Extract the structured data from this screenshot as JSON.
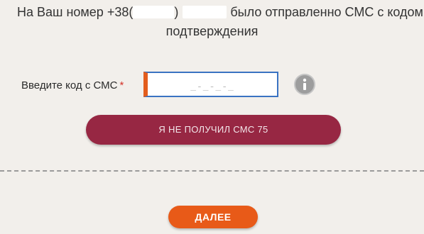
{
  "notice": {
    "prefix": "На Ваш номер +38(",
    "paren_close": ")",
    "suffix": "было отправленно СМС с кодом",
    "line2": "подтверждения"
  },
  "sms_field": {
    "label": "Введите код с СМС",
    "required_mark": "*",
    "placeholder": "_-_-_-_",
    "value": ""
  },
  "info": {
    "icon": "info-icon"
  },
  "resend_button": {
    "label": "Я НЕ ПОЛУЧИЛ СМС 75"
  },
  "next_button": {
    "label": "ДАЛЕЕ"
  },
  "colors": {
    "background": "#f2efeb",
    "input_accent": "#e35d1d",
    "input_border": "#3a73c2",
    "resend_bg": "#972743",
    "next_bg": "#e85a18",
    "required": "#d4342a"
  }
}
